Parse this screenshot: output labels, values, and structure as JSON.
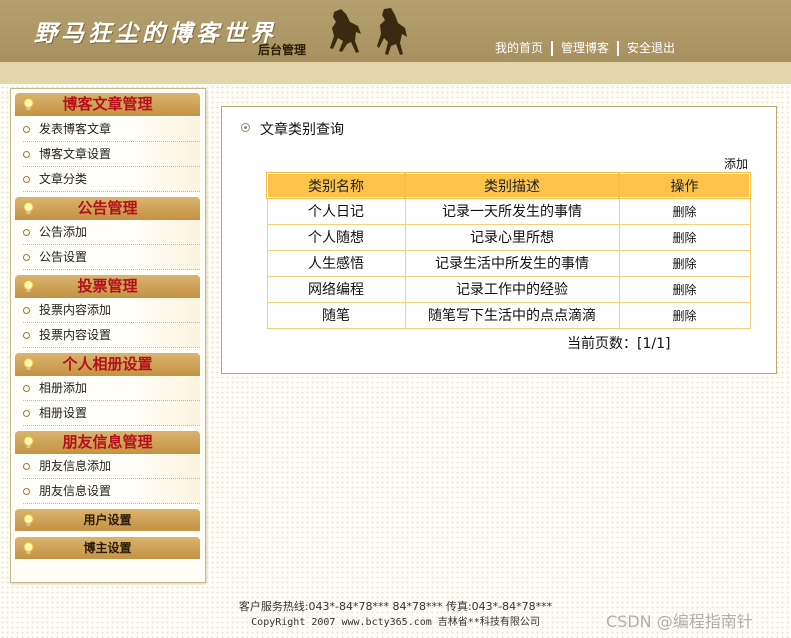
{
  "header": {
    "site_title": "野马狂尘的博客世界",
    "admin_label": "后台管理",
    "nav": [
      "我的首页",
      "管理博客",
      "安全退出"
    ],
    "bg_color": "#a89160"
  },
  "sidebar": {
    "sections": [
      {
        "title": "博客文章管理",
        "items": [
          "发表博客文章",
          "博客文章设置",
          "文章分类"
        ]
      },
      {
        "title": "公告管理",
        "items": [
          "公告添加",
          "公告设置"
        ]
      },
      {
        "title": "投票管理",
        "items": [
          "投票内容添加",
          "投票内容设置"
        ]
      },
      {
        "title": "个人相册设置",
        "items": [
          "相册添加",
          "相册设置"
        ]
      },
      {
        "title": "朋友信息管理",
        "items": [
          "朋友信息添加",
          "朋友信息设置"
        ]
      },
      {
        "title": "用户设置",
        "items": []
      },
      {
        "title": "博主设置",
        "items": []
      }
    ]
  },
  "main": {
    "title": "文章类别查询",
    "add_label": "添加",
    "table": {
      "headers": [
        "类别名称",
        "类别描述",
        "操作"
      ],
      "rows": [
        [
          "个人日记",
          "记录一天所发生的事情",
          "删除"
        ],
        [
          "个人随想",
          "记录心里所想",
          "删除"
        ],
        [
          "人生感悟",
          "记录生活中所发生的事情",
          "删除"
        ],
        [
          "网络编程",
          "记录工作中的经验",
          "删除"
        ],
        [
          "随笔",
          "随笔写下生活中的点点滴滴",
          "删除"
        ]
      ]
    },
    "pager": "当前页数：[1/1]"
  },
  "footer": {
    "line1": "客户服务热线:043*-84*78*** 84*78*** 传真:043*-84*78***",
    "line2": "CopyRight 2007 www.bcty365.com 吉林省**科技有限公司"
  },
  "watermark": "CSDN @编程指南针",
  "colors": {
    "accent": "#fcc24a",
    "section_title": "#b5101a"
  }
}
